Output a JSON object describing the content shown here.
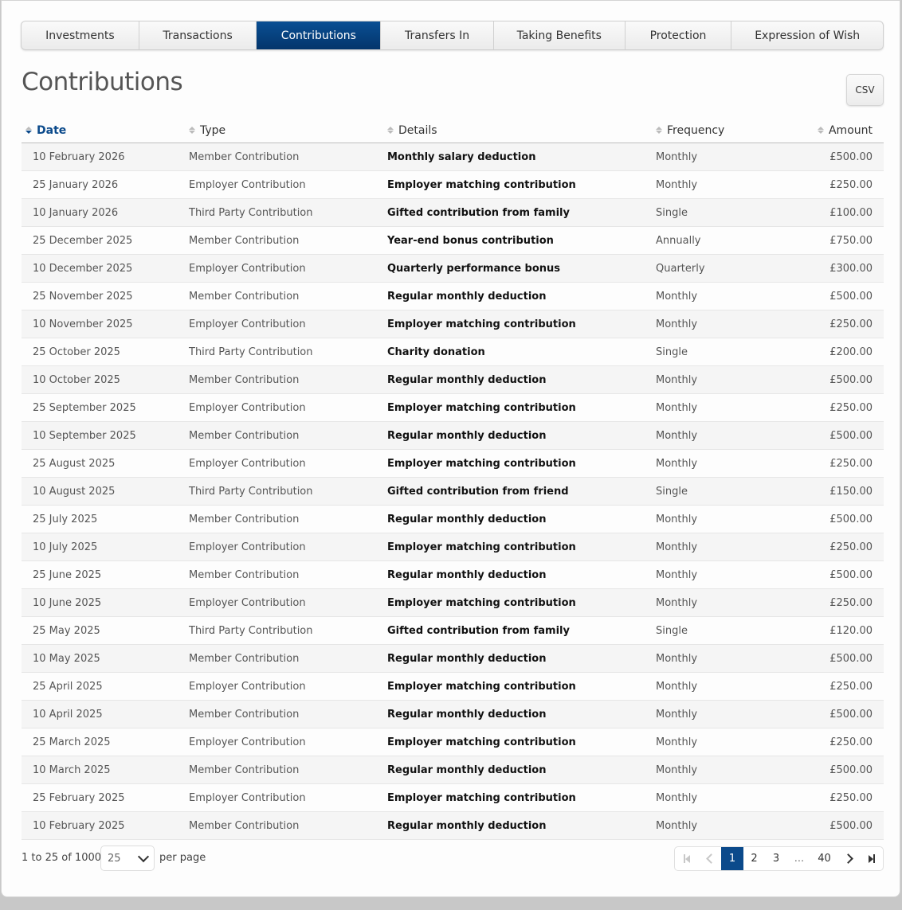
{
  "tabs": [
    {
      "label": "Investments",
      "active": false
    },
    {
      "label": "Transactions",
      "active": false
    },
    {
      "label": "Contributions",
      "active": true
    },
    {
      "label": "Transfers In",
      "active": false
    },
    {
      "label": "Taking Benefits",
      "active": false
    },
    {
      "label": "Protection",
      "active": false
    },
    {
      "label": "Expression of Wish",
      "active": false
    }
  ],
  "page_title": "Contributions",
  "csv_label": "CSV",
  "columns": {
    "date": "Date",
    "type": "Type",
    "details": "Details",
    "frequency": "Frequency",
    "amount": "Amount"
  },
  "sorted_column": "Date",
  "rows": [
    {
      "date": "10 February 2026",
      "type": "Member Contribution",
      "details": "Monthly salary deduction",
      "frequency": "Monthly",
      "amount": "£500.00"
    },
    {
      "date": "25 January 2026",
      "type": "Employer Contribution",
      "details": "Employer matching contribution",
      "frequency": "Monthly",
      "amount": "£250.00"
    },
    {
      "date": "10 January 2026",
      "type": "Third Party Contribution",
      "details": "Gifted contribution from family",
      "frequency": "Single",
      "amount": "£100.00"
    },
    {
      "date": "25 December 2025",
      "type": "Member Contribution",
      "details": "Year-end bonus contribution",
      "frequency": "Annually",
      "amount": "£750.00"
    },
    {
      "date": "10 December 2025",
      "type": "Employer Contribution",
      "details": "Quarterly performance bonus",
      "frequency": "Quarterly",
      "amount": "£300.00"
    },
    {
      "date": "25 November 2025",
      "type": "Member Contribution",
      "details": "Regular monthly deduction",
      "frequency": "Monthly",
      "amount": "£500.00"
    },
    {
      "date": "10 November 2025",
      "type": "Employer Contribution",
      "details": "Employer matching contribution",
      "frequency": "Monthly",
      "amount": "£250.00"
    },
    {
      "date": "25 October 2025",
      "type": "Third Party Contribution",
      "details": "Charity donation",
      "frequency": "Single",
      "amount": "£200.00"
    },
    {
      "date": "10 October 2025",
      "type": "Member Contribution",
      "details": "Regular monthly deduction",
      "frequency": "Monthly",
      "amount": "£500.00"
    },
    {
      "date": "25 September 2025",
      "type": "Employer Contribution",
      "details": "Employer matching contribution",
      "frequency": "Monthly",
      "amount": "£250.00"
    },
    {
      "date": "10 September 2025",
      "type": "Member Contribution",
      "details": "Regular monthly deduction",
      "frequency": "Monthly",
      "amount": "£500.00"
    },
    {
      "date": "25 August 2025",
      "type": "Employer Contribution",
      "details": "Employer matching contribution",
      "frequency": "Monthly",
      "amount": "£250.00"
    },
    {
      "date": "10 August 2025",
      "type": "Third Party Contribution",
      "details": "Gifted contribution from friend",
      "frequency": "Single",
      "amount": "£150.00"
    },
    {
      "date": "25 July 2025",
      "type": "Member Contribution",
      "details": "Regular monthly deduction",
      "frequency": "Monthly",
      "amount": "£500.00"
    },
    {
      "date": "10 July 2025",
      "type": "Employer Contribution",
      "details": "Employer matching contribution",
      "frequency": "Monthly",
      "amount": "£250.00"
    },
    {
      "date": "25 June 2025",
      "type": "Member Contribution",
      "details": "Regular monthly deduction",
      "frequency": "Monthly",
      "amount": "£500.00"
    },
    {
      "date": "10 June 2025",
      "type": "Employer Contribution",
      "details": "Employer matching contribution",
      "frequency": "Monthly",
      "amount": "£250.00"
    },
    {
      "date": "25 May 2025",
      "type": "Third Party Contribution",
      "details": "Gifted contribution from family",
      "frequency": "Single",
      "amount": "£120.00"
    },
    {
      "date": "10 May 2025",
      "type": "Member Contribution",
      "details": "Regular monthly deduction",
      "frequency": "Monthly",
      "amount": "£500.00"
    },
    {
      "date": "25 April 2025",
      "type": "Employer Contribution",
      "details": "Employer matching contribution",
      "frequency": "Monthly",
      "amount": "£250.00"
    },
    {
      "date": "10 April 2025",
      "type": "Member Contribution",
      "details": "Regular monthly deduction",
      "frequency": "Monthly",
      "amount": "£500.00"
    },
    {
      "date": "25 March 2025",
      "type": "Employer Contribution",
      "details": "Employer matching contribution",
      "frequency": "Monthly",
      "amount": "£250.00"
    },
    {
      "date": "10 March 2025",
      "type": "Member Contribution",
      "details": "Regular monthly deduction",
      "frequency": "Monthly",
      "amount": "£500.00"
    },
    {
      "date": "25 February 2025",
      "type": "Employer Contribution",
      "details": "Employer matching contribution",
      "frequency": "Monthly",
      "amount": "£250.00"
    },
    {
      "date": "10 February 2025",
      "type": "Member Contribution",
      "details": "Regular monthly deduction",
      "frequency": "Monthly",
      "amount": "£500.00"
    }
  ],
  "footer": {
    "range_text": "1 to 25 of 1000",
    "per_page_value": "25",
    "per_page_label": "per page"
  },
  "pagination": {
    "pages": [
      "1",
      "2",
      "3",
      "...",
      "40"
    ],
    "current": "1"
  },
  "colors": {
    "accent": "#0b4a8b",
    "tab_active_top": "#0a4f94",
    "tab_active_bottom": "#03356b"
  },
  "icons": {
    "first": "first-page-icon",
    "prev": "chevron-left-icon",
    "next": "chevron-right-icon",
    "last": "last-page-icon",
    "sort": "sort-icon",
    "dropdown": "chevron-down-icon"
  }
}
